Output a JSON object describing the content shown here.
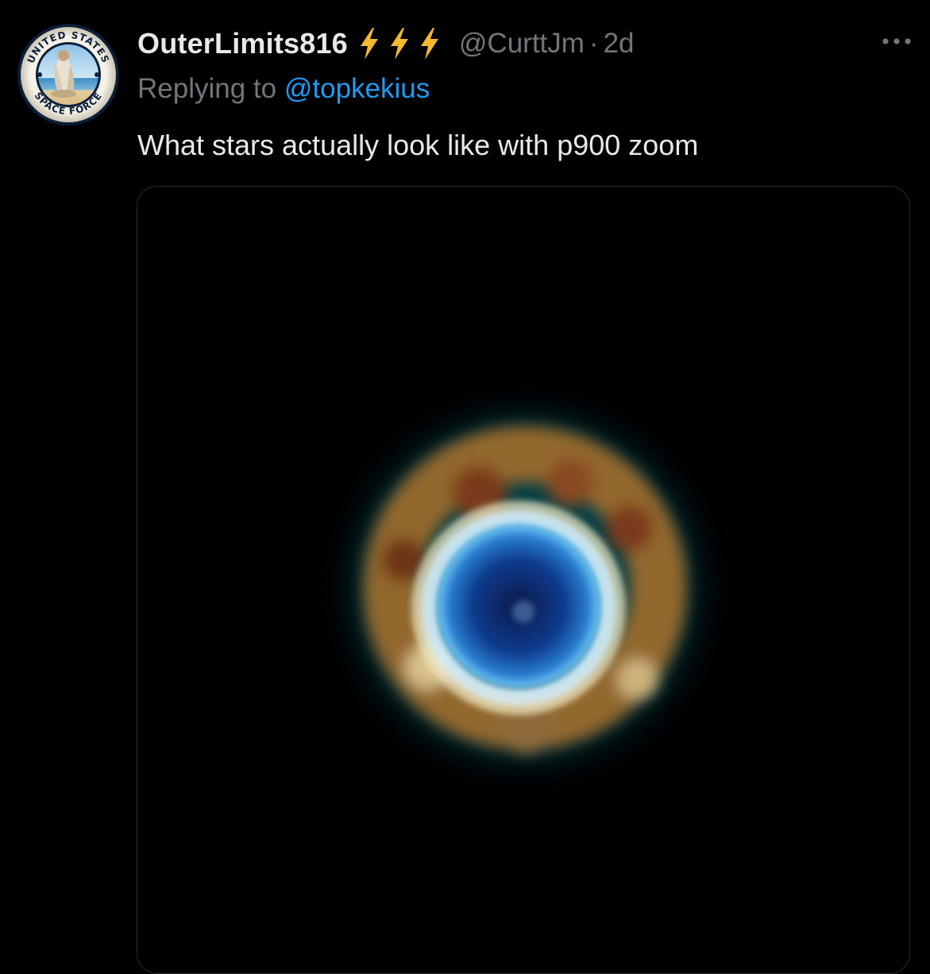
{
  "tweet": {
    "display_name": "OuterLimits816",
    "badge_icon": "lightning-bolt-icon",
    "badge_count": 3,
    "badge_color": "#f5b82e",
    "handle": "@CurttJm",
    "separator": "·",
    "time": "2d",
    "replying_prefix": "Replying to",
    "replying_to": "@topkekius",
    "text": "What stars actually look like with p900 zoom",
    "more_icon": "more-horizontal-icon"
  },
  "avatar": {
    "seal_text_top": "UNITED STATES",
    "seal_text_bottom": "SPACE FORCE"
  },
  "colors": {
    "background": "#000000",
    "primary_text": "#e7e9ea",
    "secondary_text": "#71767b",
    "link": "#1d9bf0"
  }
}
